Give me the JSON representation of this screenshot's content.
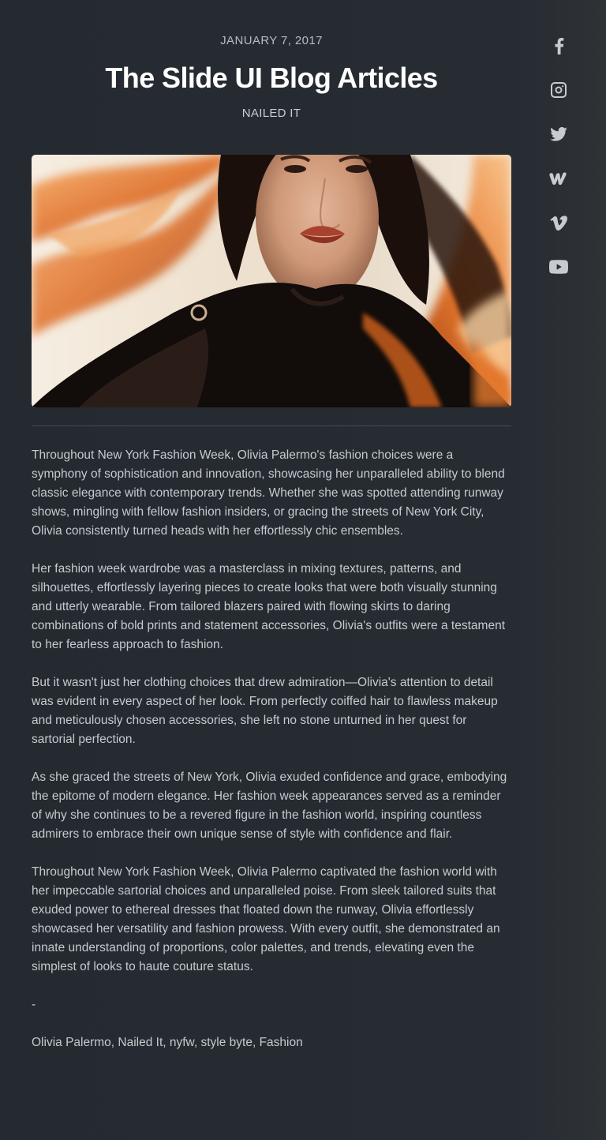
{
  "post": {
    "date": "JANUARY 7, 2017",
    "title": "The Slide UI Blog Articles",
    "category": "NAILED IT"
  },
  "hero_image": {
    "description": "editorial fashion portrait with flowing orange hair"
  },
  "article": {
    "paragraphs": [
      "Throughout New York Fashion Week, Olivia Palermo's fashion choices were a symphony of sophistication and innovation, showcasing her unparalleled ability to blend classic elegance with contemporary trends. Whether she was spotted attending runway shows, mingling with fellow fashion insiders, or gracing the streets of New York City, Olivia consistently turned heads with her effortlessly chic ensembles.",
      "Her fashion week wardrobe was a masterclass in mixing textures, patterns, and silhouettes, effortlessly layering pieces to create looks that were both visually stunning and utterly wearable. From tailored blazers paired with flowing skirts to daring combinations of bold prints and statement accessories, Olivia's outfits were a testament to her fearless approach to fashion.",
      "But it wasn't just her clothing choices that drew admiration—Olivia's attention to detail was evident in every aspect of her look. From perfectly coiffed hair to flawless makeup and meticulously chosen accessories, she left no stone unturned in her quest for sartorial perfection.",
      "As she graced the streets of New York, Olivia exuded confidence and grace, embodying the epitome of modern elegance. Her fashion week appearances served as a reminder of why she continues to be a revered figure in the fashion world, inspiring countless admirers to embrace their own unique sense of style with confidence and flair.",
      "Throughout New York Fashion Week, Olivia Palermo captivated the fashion world with her impeccable sartorial choices and unparalleled poise. From sleek tailored suits that exuded power to ethereal dresses that floated down the runway, Olivia effortlessly showcased her versatility and fashion prowess. With every outfit, she demonstrated an innate understanding of proportions, color palettes, and trends, elevating even the simplest of looks to haute couture status."
    ],
    "separator": "-",
    "tags": "Olivia Palermo, Nailed It, nyfw, style byte, Fashion"
  },
  "social": {
    "icons": [
      "facebook-icon",
      "instagram-icon",
      "twitter-icon",
      "wattpad-icon",
      "vimeo-icon",
      "youtube-icon"
    ]
  },
  "colors": {
    "background": "#272b30",
    "title": "#ffffff",
    "text": "#c6cace",
    "divider": "#474c53",
    "icon": "#c7cbd0"
  }
}
